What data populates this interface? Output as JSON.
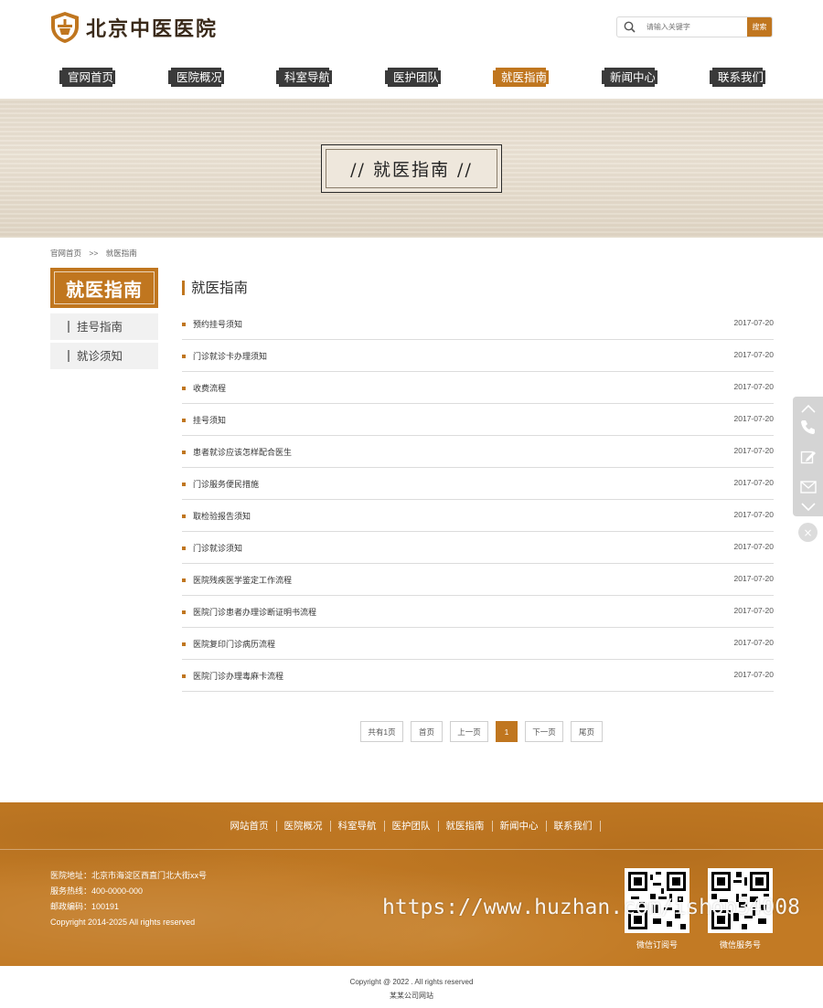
{
  "header": {
    "logo_text": "北京中医医院",
    "search_placeholder": "请输入关键字",
    "search_button": "搜索"
  },
  "nav": [
    "官网首页",
    "医院概况",
    "科室导航",
    "医护团队",
    "就医指南",
    "新闻中心",
    "联系我们"
  ],
  "nav_active_index": 4,
  "banner": {
    "title": "// 就医指南 //"
  },
  "breadcrumb": {
    "home": "官网首页",
    "sep": ">>",
    "current": "就医指南"
  },
  "sidebar_nav": {
    "title": "就医指南",
    "items": [
      "挂号指南",
      "就诊须知"
    ]
  },
  "main": {
    "title": "就医指南",
    "articles": [
      {
        "title": "预约挂号须知",
        "date": "2017-07-20"
      },
      {
        "title": "门诊就诊卡办理须知",
        "date": "2017-07-20"
      },
      {
        "title": "收费流程",
        "date": "2017-07-20"
      },
      {
        "title": "挂号须知",
        "date": "2017-07-20"
      },
      {
        "title": "患者就诊应该怎样配合医生",
        "date": "2017-07-20"
      },
      {
        "title": "门诊服务便民措施",
        "date": "2017-07-20"
      },
      {
        "title": "取检验报告须知",
        "date": "2017-07-20"
      },
      {
        "title": "门诊就诊须知",
        "date": "2017-07-20"
      },
      {
        "title": "医院残疾医学鉴定工作流程",
        "date": "2017-07-20"
      },
      {
        "title": "医院门诊患者办理诊断证明书流程",
        "date": "2017-07-20"
      },
      {
        "title": "医院复印门诊病历流程",
        "date": "2017-07-20"
      },
      {
        "title": "医院门诊办理毒麻卡流程",
        "date": "2017-07-20"
      }
    ]
  },
  "pager": {
    "total": "共有1页",
    "first": "首页",
    "prev": "上一页",
    "current": "1",
    "next": "下一页",
    "last": "尾页"
  },
  "float_bar": {
    "icons": [
      "chevron-up-icon",
      "phone-icon",
      "edit-icon",
      "mail-icon",
      "chevron-down-icon"
    ],
    "close": "×"
  },
  "footer": {
    "nav": [
      "网站首页",
      "医院概况",
      "科室导航",
      "医护团队",
      "就医指南",
      "新闻中心",
      "联系我们"
    ],
    "address": "医院地址：北京市海淀区西直门北大街xx号",
    "hotline": "服务热线：400-0000-000",
    "postcode": "邮政编码：100191",
    "copyright": "Copyright 2014-2025    All rights reserved",
    "qr_labels": [
      "微信订阅号",
      "微信服务号"
    ],
    "watermark": "https://www.huzhan.com/ishop34008"
  },
  "bottom": {
    "copyright": "Copyright @ 2022 . All rights reserved",
    "site": "某某公司网站"
  },
  "colors": {
    "accent": "#c0761f",
    "nav_dark": "#3a3a3a",
    "footer_bg": "#c27a24"
  }
}
